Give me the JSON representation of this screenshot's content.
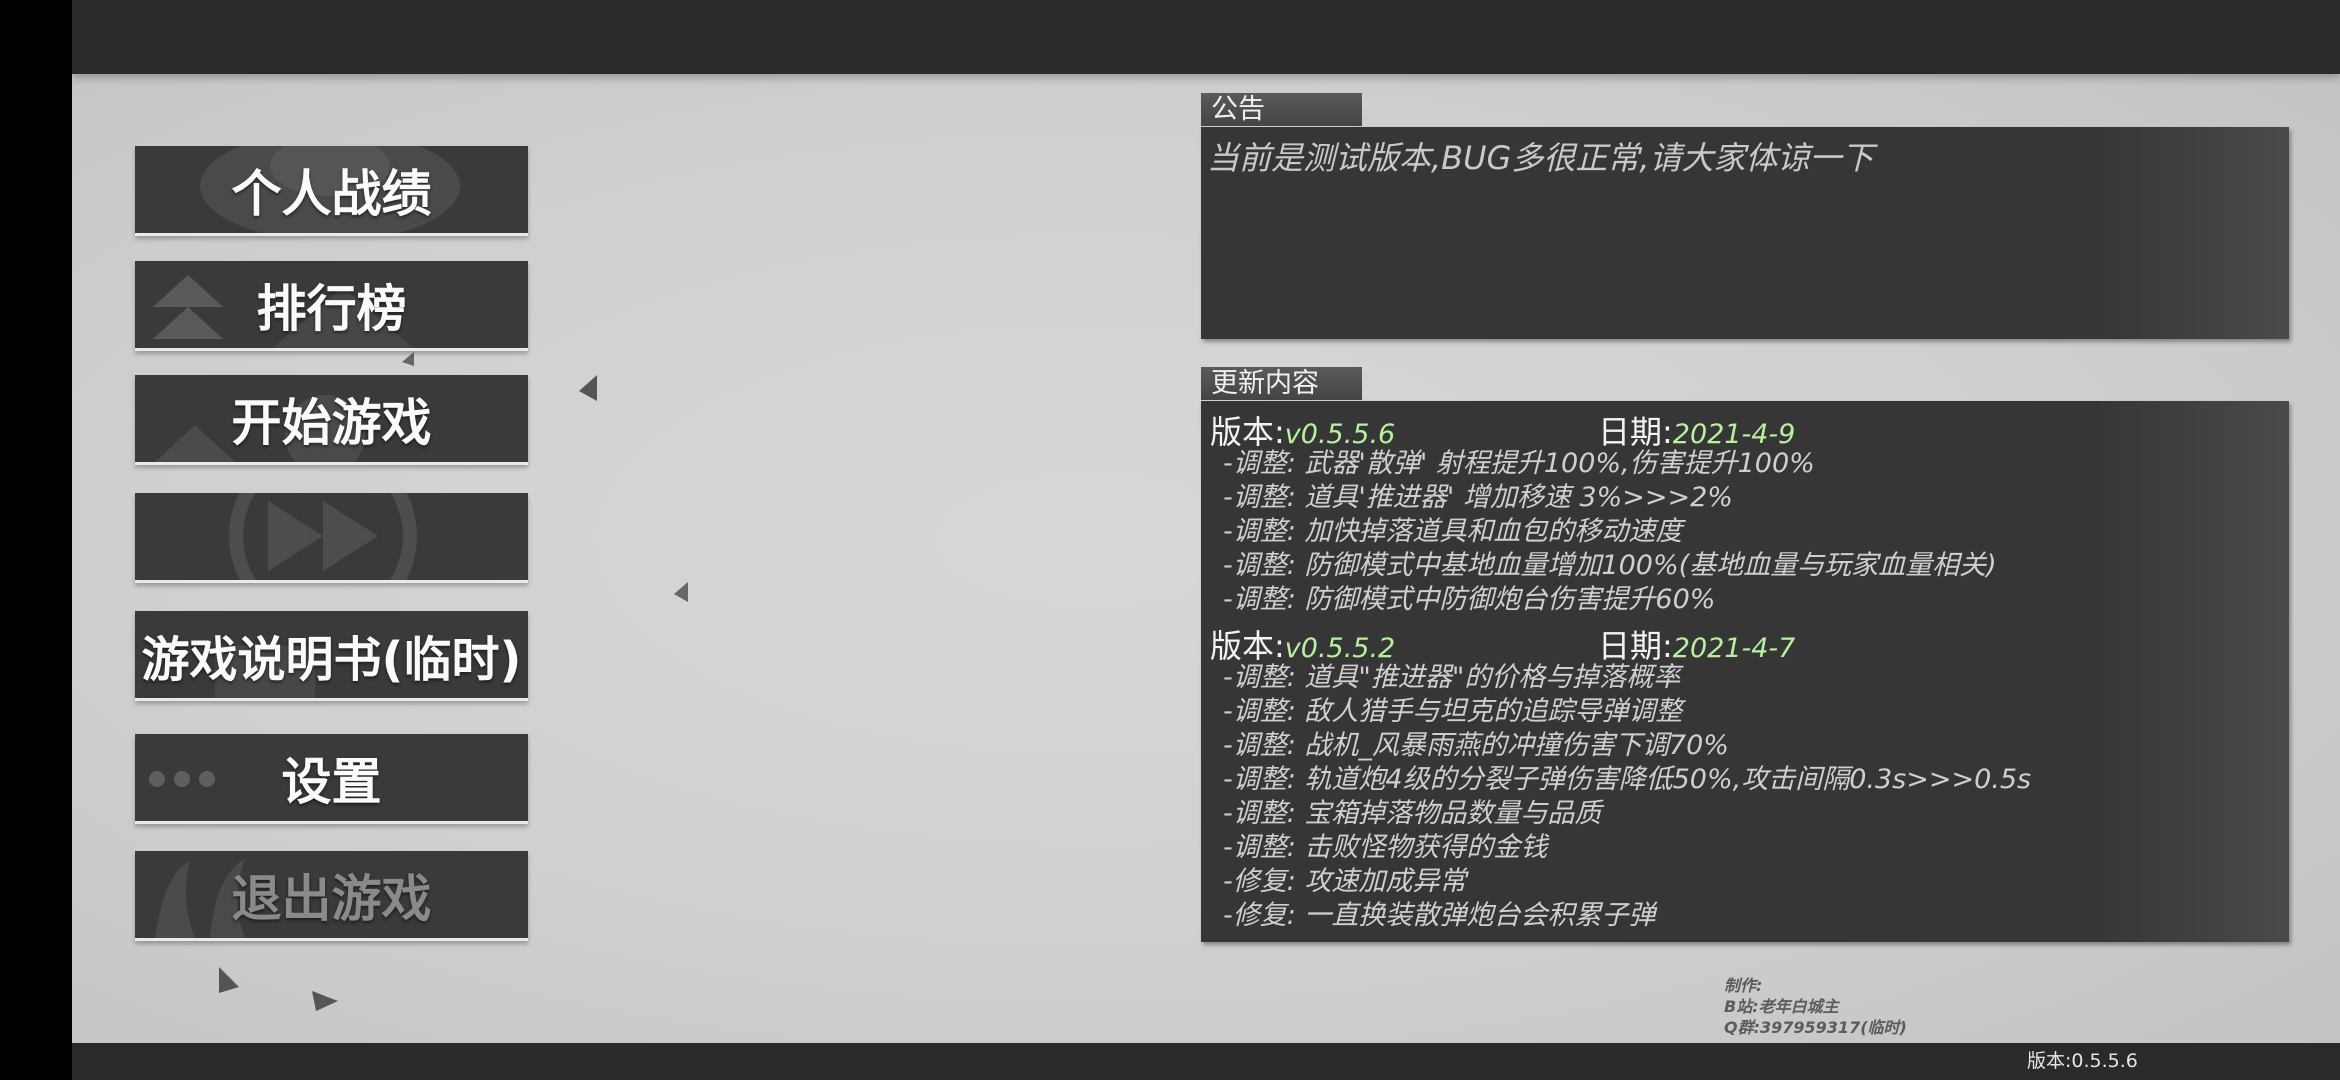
{
  "menu": {
    "stats": "个人战绩",
    "leaderboard": "排行榜",
    "start": "开始游戏",
    "fast_forward_label": "",
    "manual": "游戏说明书(临时)",
    "settings": "设置",
    "quit": "退出游戏"
  },
  "notice": {
    "tab": "公告",
    "text": "当前是测试版本,BUG多很正常,请大家体谅一下"
  },
  "updates": {
    "tab": "更新内容",
    "version_key": "版本:",
    "date_key": "日期:",
    "entries": [
      {
        "version": "v0.5.5.6",
        "date": "2021-4-9",
        "changes": [
          "-调整: 武器'散弹' 射程提升100%,伤害提升100%",
          "-调整: 道具'推进器' 增加移速 3%>>>2%",
          "-调整: 加快掉落道具和血包的移动速度",
          "-调整: 防御模式中基地血量增加100%(基地血量与玩家血量相关)",
          "-调整: 防御模式中防御炮台伤害提升60%"
        ]
      },
      {
        "version": "v0.5.5.2",
        "date": "2021-4-7",
        "changes": [
          "-调整: 道具\"推进器\"的价格与掉落概率",
          "-调整: 敌人猎手与坦克的追踪导弹调整",
          "-调整: 战机_风暴雨燕的冲撞伤害下调70%",
          "-调整: 轨道炮4级的分裂子弹伤害降低50%,攻击间隔0.3s>>>0.5s",
          "-调整: 宝箱掉落物品数量与品质",
          "-调整: 击败怪物获得的金钱",
          "-修复: 攻速加成异常",
          "-修复: 一直换装散弹炮台会积累子弹"
        ]
      }
    ]
  },
  "credits": {
    "line1": "制作:",
    "line2": "B站:老年白城主",
    "line3": "Q群:397959317(临时)"
  },
  "footer": {
    "version": "版本:0.5.5.6"
  },
  "colors": {
    "accent_green": "#b8f0a0",
    "panel_bg": "#363636",
    "button_bg": "#3a3a3a"
  },
  "icons": {
    "leaderboard": "double-chevron-up-icon",
    "fast_forward": "fast-forward-icon",
    "settings": "ellipsis-icon"
  }
}
